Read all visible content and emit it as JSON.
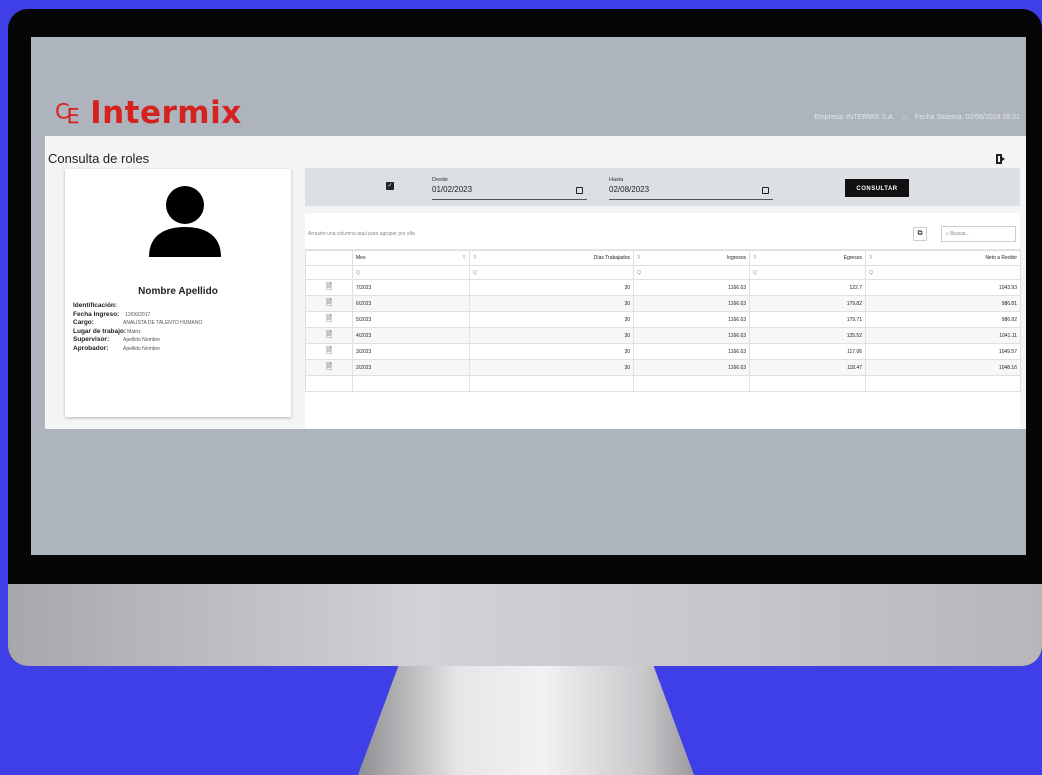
{
  "header": {
    "logo_text": "Intermix",
    "company_label": "Empresa: INTERMIX S.A.",
    "date_label": "Fecha Sistema: 02/08/2023 09:21"
  },
  "page": {
    "title": "Consulta de roles"
  },
  "profile": {
    "name": "Nombre Apellido",
    "fields": [
      {
        "label": "Identificación:",
        "value": ""
      },
      {
        "label": "Fecha Ingreso:",
        "value": "12/06/2017"
      },
      {
        "label": "Cargo:",
        "value": "ANALISTA DE TALENTO HUMANO"
      },
      {
        "label": "Lugar de trabajo:",
        "value": "Matriz"
      },
      {
        "label": "Supervisor:",
        "value": "Apellido Nombre"
      },
      {
        "label": "Aprobador:",
        "value": "Apellido Nombre"
      }
    ]
  },
  "filter": {
    "desde_label": "Desde",
    "desde_value": "01/02/2023",
    "hasta_label": "Hasta",
    "hasta_value": "02/08/2023",
    "consultar_label": "CONSULTAR"
  },
  "grid": {
    "group_hint": "Arrastre una columna aquí para agrupar por ella",
    "search_placeholder": "Buscar...",
    "columns": [
      "Mes",
      "Días Trabajados",
      "Ingresos",
      "Egresos",
      "Neto a Recibir"
    ],
    "filter_symbol": "Q",
    "rows": [
      {
        "mes": "7/2023",
        "dias": "30",
        "ingresos": "1166.63",
        "egresos": "122.7",
        "neto": "1043.93"
      },
      {
        "mes": "6/2023",
        "dias": "30",
        "ingresos": "1166.63",
        "egresos": "179.82",
        "neto": "986.81"
      },
      {
        "mes": "5/2023",
        "dias": "30",
        "ingresos": "1166.63",
        "egresos": "179.71",
        "neto": "986.92"
      },
      {
        "mes": "4/2023",
        "dias": "30",
        "ingresos": "1166.63",
        "egresos": "125.52",
        "neto": "1041.11"
      },
      {
        "mes": "3/2023",
        "dias": "30",
        "ingresos": "1166.63",
        "egresos": "117.06",
        "neto": "1049.57"
      },
      {
        "mes": "2/2023",
        "dias": "30",
        "ingresos": "1166.63",
        "egresos": "118.47",
        "neto": "1048.16"
      }
    ]
  },
  "colors": {
    "background": "#3f3fe8",
    "logo_red": "#d6221f",
    "screen_gray": "#adb4bd",
    "button_black": "#111111"
  }
}
